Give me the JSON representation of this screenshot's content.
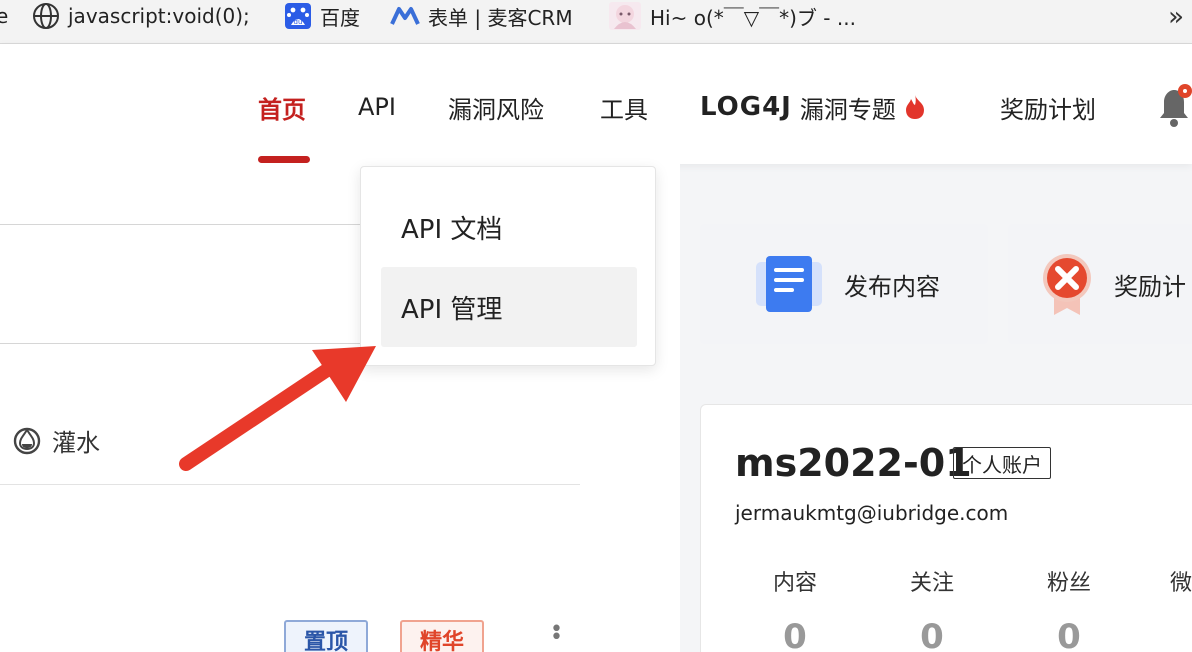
{
  "bookmarks": {
    "items": [
      {
        "label": "javascript:void(0);",
        "icon": "globe-icon"
      },
      {
        "label": "百度",
        "icon": "baidu-icon"
      },
      {
        "label": "表单 | 麦客CRM",
        "icon": "maike-icon"
      },
      {
        "label": "Hi~ o(*￣▽￣*)ブ - ...",
        "icon": "anime-avatar-icon"
      }
    ],
    "more_label": "»"
  },
  "nav": {
    "items": [
      {
        "label": "首页",
        "active": true
      },
      {
        "label": "API"
      },
      {
        "label": "漏洞风险"
      },
      {
        "label": "工具"
      },
      {
        "logo": "LOG4J",
        "label": "漏洞专题",
        "icon": "fire-icon"
      },
      {
        "label": "奖励计划"
      }
    ],
    "notification_icon": "bell-icon",
    "accent_color": "#c4211f"
  },
  "dropdown": {
    "items": [
      {
        "label": "API 文档"
      },
      {
        "label": "API 管理",
        "hovered": true
      }
    ]
  },
  "left": {
    "tag_label": "灌水",
    "tag_icon": "droplet-icon",
    "badges": {
      "pin": "置顶",
      "pick": "精华"
    }
  },
  "cards": {
    "publish": {
      "label": "发布内容",
      "icon": "document-icon"
    },
    "reward": {
      "label": "奖励计",
      "icon": "reward-badge-icon"
    }
  },
  "profile": {
    "username": "ms2022-01",
    "account_type": "个人账户",
    "email": "jermaukmtg@iubridge.com",
    "stats": [
      {
        "label": "内容",
        "value": "0"
      },
      {
        "label": "关注",
        "value": "0"
      },
      {
        "label": "粉丝",
        "value": "0"
      },
      {
        "label": "微",
        "value": ""
      }
    ]
  }
}
